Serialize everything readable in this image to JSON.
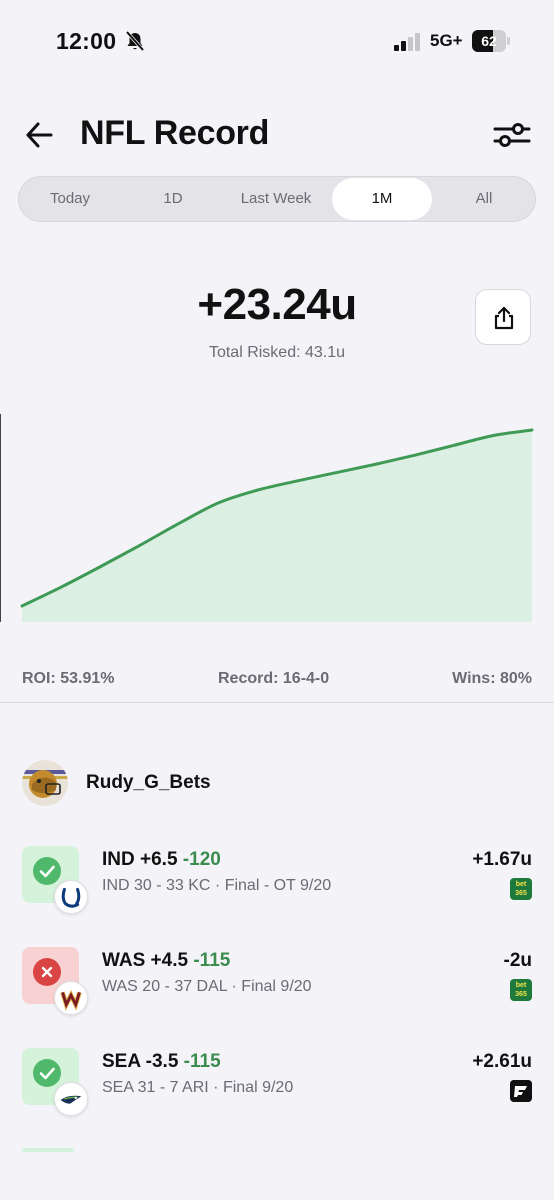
{
  "status": {
    "time": "12:00",
    "network": "5G+",
    "battery_level": "62",
    "battery_fraction": 0.62
  },
  "header": {
    "title": "NFL Record"
  },
  "tabs": [
    {
      "label": "Today",
      "active": false
    },
    {
      "label": "1D",
      "active": false
    },
    {
      "label": "Last Week",
      "active": false
    },
    {
      "label": "1M",
      "active": true
    },
    {
      "label": "All",
      "active": false
    }
  ],
  "summary": {
    "total": "+23.24u",
    "risked": "Total Risked: 43.1u"
  },
  "chart_data": {
    "type": "area",
    "title": "",
    "xlabel": "",
    "ylabel": "",
    "y": [
      0,
      2.5,
      5.2,
      8.0,
      10.9,
      13.6,
      15.3,
      16.5,
      17.6,
      18.7,
      19.9,
      21.2,
      22.5,
      23.24
    ],
    "ylim": [
      0,
      23.24
    ],
    "line_color": "#3f9a56",
    "fill_color": "#dcefe3",
    "grid": false
  },
  "stats": {
    "roi": "ROI: 53.91%",
    "record": "Record: 16-4-0",
    "wins": "Wins: 80%"
  },
  "user": {
    "name": "Rudy_G_Bets"
  },
  "bets": [
    {
      "status": "win",
      "team": "IND",
      "pick": "IND +6.5",
      "odds": "-120",
      "detail": "IND 30 - 33 KC · Final - OT 9/20",
      "result": "+1.67u",
      "book": "bet365"
    },
    {
      "status": "loss",
      "team": "WAS",
      "pick": "WAS +4.5",
      "odds": "-115",
      "detail": "WAS 20 - 37 DAL · Final 9/20",
      "result": "-2u",
      "book": "bet365"
    },
    {
      "status": "win",
      "team": "SEA",
      "pick": "SEA -3.5",
      "odds": "-115",
      "detail": "SEA 31 - 7 ARI · Final 9/20",
      "result": "+2.61u",
      "book": "fanatics"
    }
  ],
  "book_labels": {
    "bet365_top": "bet",
    "bet365_bottom": "365"
  },
  "colors": {
    "win": "#4fb86a",
    "loss": "#d94444",
    "odds_green": "#3a8c4f"
  }
}
